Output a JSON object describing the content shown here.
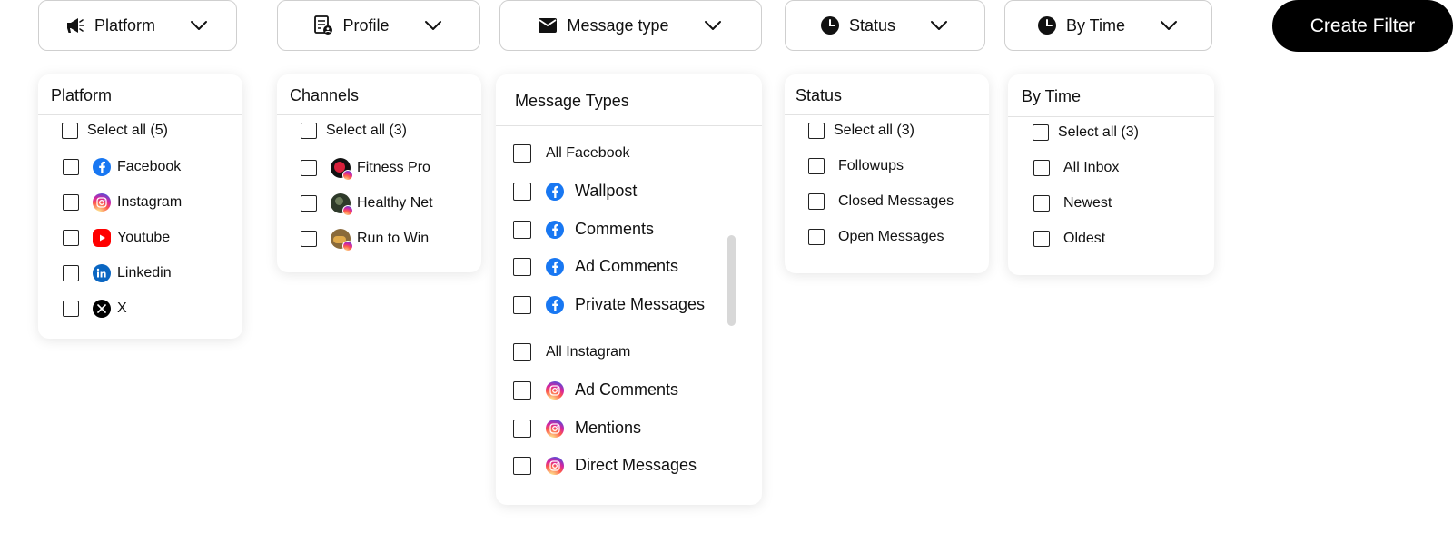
{
  "toolbar": {
    "platform_label": "Platform",
    "profile_label": "Profile",
    "message_type_label": "Message type",
    "status_label": "Status",
    "by_time_label": "By Time",
    "create_filter_label": "Create Filter"
  },
  "platform_panel": {
    "title": "Platform",
    "select_all": "Select all (5)",
    "items": [
      {
        "label": "Facebook",
        "icon": "facebook-icon"
      },
      {
        "label": "Instagram",
        "icon": "instagram-icon"
      },
      {
        "label": "Youtube",
        "icon": "youtube-icon"
      },
      {
        "label": "Linkedin",
        "icon": "linkedin-icon"
      },
      {
        "label": "X",
        "icon": "x-icon"
      }
    ]
  },
  "channels_panel": {
    "title": "Channels",
    "select_all": "Select all (3)",
    "items": [
      {
        "label": "Fitness Pro"
      },
      {
        "label": "Healthy Net"
      },
      {
        "label": "Run to Win"
      }
    ]
  },
  "message_types_panel": {
    "title": "Message Types",
    "facebook_group": {
      "header": "All Facebook",
      "items": [
        "Wallpost",
        "Comments",
        "Ad Comments",
        "Private Messages"
      ]
    },
    "instagram_group": {
      "header": "All Instagram",
      "items": [
        "Ad Comments",
        "Mentions",
        "Direct Messages"
      ]
    }
  },
  "status_panel": {
    "title": "Status",
    "select_all": "Select all (3)",
    "items": [
      "Followups",
      "Closed Messages",
      "Open Messages"
    ]
  },
  "by_time_panel": {
    "title": "By Time",
    "select_all": "Select all (3)",
    "items": [
      "All Inbox",
      "Newest",
      "Oldest"
    ]
  },
  "colors": {
    "facebook": "#1877F2",
    "youtube": "#FF0000",
    "linkedin": "#0A66C2",
    "x": "#000000",
    "create_button": "#000000"
  }
}
